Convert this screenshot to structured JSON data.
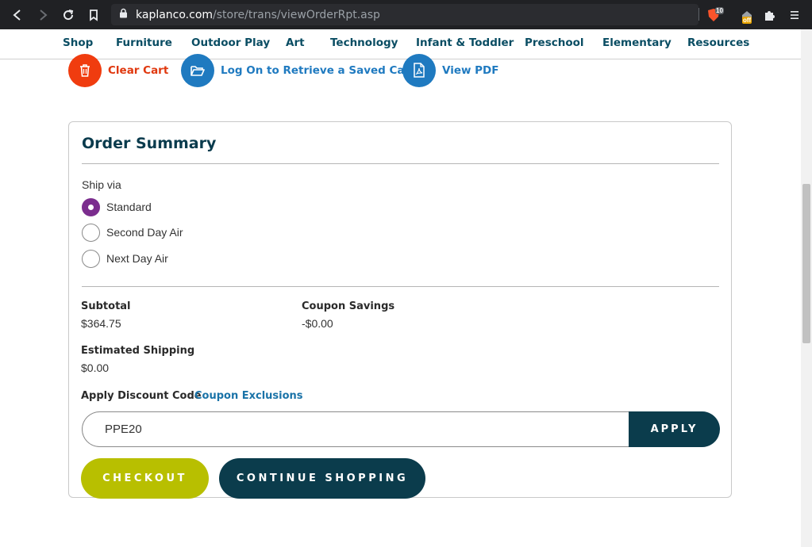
{
  "browser": {
    "url_host": "kaplanco.com",
    "url_path": "/store/trans/viewOrderRpt.asp",
    "shield_count": "10",
    "ext_badge": "off"
  },
  "site_nav": {
    "items": [
      "Shop",
      "Furniture",
      "Outdoor Play",
      "Art",
      "Technology",
      "Infant & Toddler",
      "Preschool",
      "Elementary",
      "Resources"
    ]
  },
  "cart_actions": {
    "clear": "Clear Cart",
    "retrieve": "Log On to Retrieve a Saved Cart",
    "pdf": "View PDF"
  },
  "order_summary": {
    "title": "Order Summary",
    "ship_via_label": "Ship via",
    "ship_options": [
      {
        "label": "Standard",
        "selected": true
      },
      {
        "label": "Second Day Air",
        "selected": false
      },
      {
        "label": "Next Day Air",
        "selected": false
      }
    ],
    "subtotal_label": "Subtotal",
    "subtotal_value": "$364.75",
    "coupon_label": "Coupon Savings",
    "coupon_value": "-$0.00",
    "shipping_label": "Estimated Shipping",
    "shipping_value": "$0.00",
    "discount_label": "Apply Discount Code",
    "exclusions_link": "Coupon Exclusions",
    "discount_code": "PPE20",
    "apply_label": "APPLY",
    "checkout_label": "CHECKOUT",
    "continue_label": "CONTINUE SHOPPING"
  },
  "colors": {
    "brand_dark": "#0b3c4c",
    "clear_red": "#f03c0f",
    "action_blue": "#1f7ac0",
    "checkout_green": "#b8bf00",
    "radio_purple": "#7b2d8e"
  }
}
